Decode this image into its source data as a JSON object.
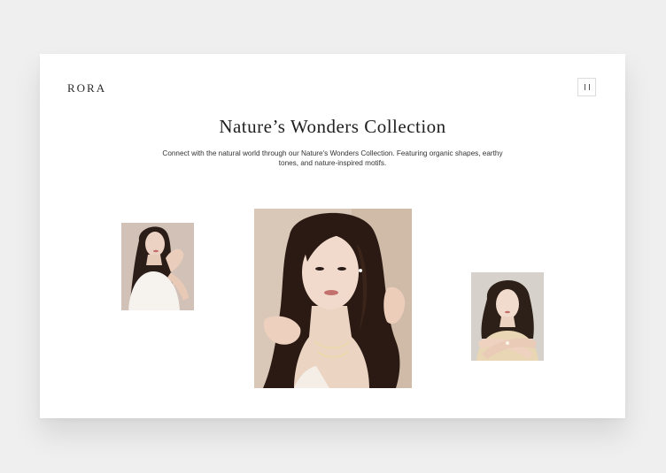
{
  "header": {
    "logo": "RORA",
    "menu_icon": "pause-icon"
  },
  "hero": {
    "title": "Nature’s Wonders Collection",
    "description": "Connect with the natural world through our Nature's Wonders Collection. Featuring organic shapes, earthy tones, and nature-inspired motifs."
  },
  "gallery": {
    "photos": [
      {
        "name": "model-photo-left"
      },
      {
        "name": "model-photo-center"
      },
      {
        "name": "model-photo-right"
      }
    ]
  },
  "colors": {
    "background": "#efefef",
    "card": "#ffffff",
    "text": "#1f1f1f"
  }
}
